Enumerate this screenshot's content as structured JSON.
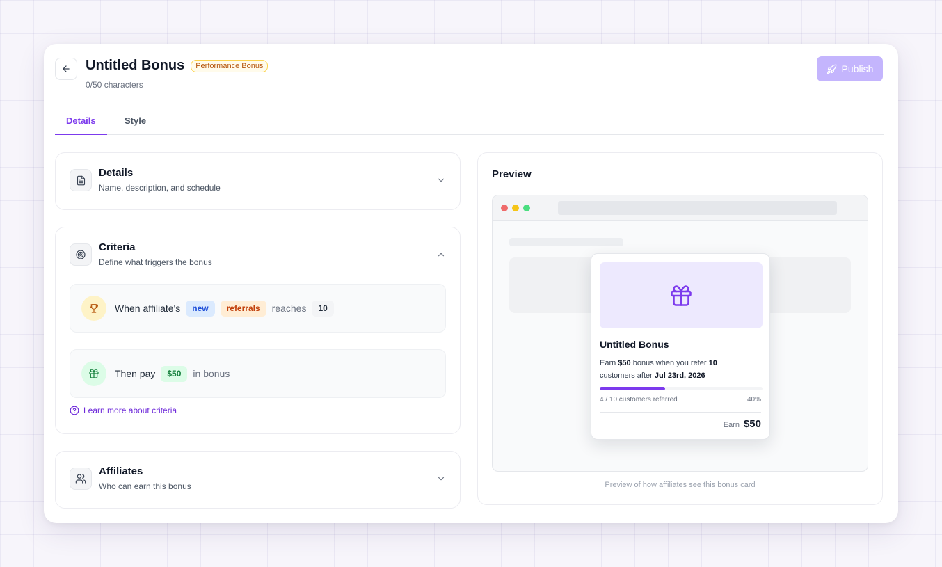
{
  "header": {
    "title": "Untitled Bonus",
    "type_badge": "Performance Bonus",
    "char_count": "0/50 characters",
    "publish_label": "Publish"
  },
  "tabs": [
    {
      "label": "Details",
      "active": true
    },
    {
      "label": "Style",
      "active": false
    }
  ],
  "sections": {
    "details": {
      "title": "Details",
      "subtitle": "Name, description, and schedule",
      "icon": "document-icon",
      "expanded": false
    },
    "criteria": {
      "title": "Criteria",
      "subtitle": "Define what triggers the bonus",
      "icon": "target-icon",
      "expanded": true,
      "rule": {
        "prefix": "When affiliate's",
        "chip_type": "new",
        "chip_metric": "referrals",
        "verb": "reaches",
        "threshold": "10"
      },
      "payout": {
        "prefix": "Then pay",
        "amount": "$50",
        "suffix": "in bonus"
      },
      "learn_more": "Learn more about criteria"
    },
    "affiliates": {
      "title": "Affiliates",
      "subtitle": "Who can earn this bonus",
      "icon": "users-icon",
      "expanded": false
    }
  },
  "preview": {
    "title": "Preview",
    "caption": "Preview of how affiliates see this bonus card",
    "card": {
      "title": "Untitled Bonus",
      "desc_earn": "Earn",
      "desc_amount": "$50",
      "desc_mid": "bonus when you refer",
      "desc_count": "10",
      "desc_after": "customers after",
      "desc_date": "Jul 23rd, 2026",
      "progress_label": "4 / 10 customers referred",
      "progress_pct": "40%",
      "progress_value": 0.4,
      "earn_label": "Earn",
      "earn_amount": "$50"
    }
  },
  "colors": {
    "accent": "#7c3aed",
    "publish_disabled": "#c4b5fd",
    "dot_red": "#ef6b6b",
    "dot_yellow": "#f5c518",
    "dot_green": "#4ade80"
  }
}
